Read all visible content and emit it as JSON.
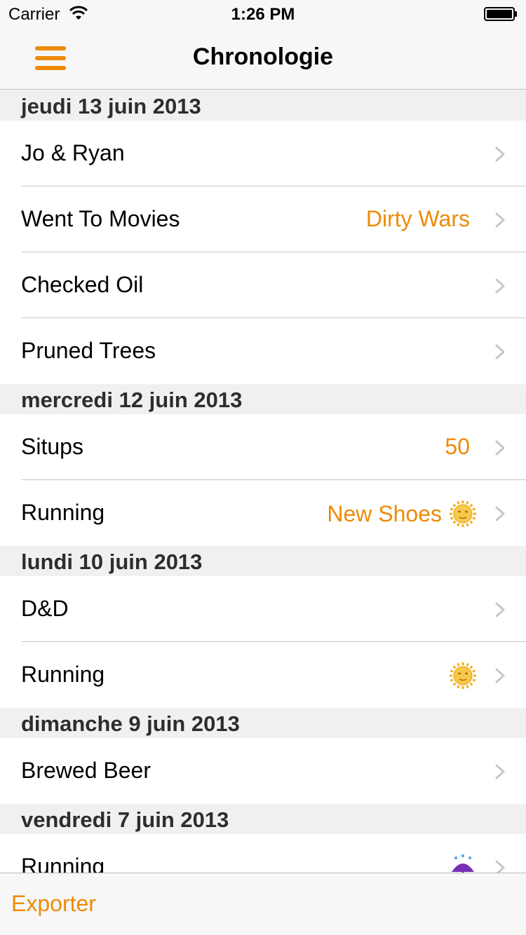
{
  "status_bar": {
    "carrier": "Carrier",
    "time": "1:26 PM"
  },
  "nav": {
    "title": "Chronologie",
    "menu_icon": "hamburger-menu-icon"
  },
  "accent_color": "#ee8a06",
  "sections": [
    {
      "date": "jeudi 13 juin 2013",
      "rows": [
        {
          "title": "Jo & Ryan",
          "detail": "",
          "icon": ""
        },
        {
          "title": "Went To Movies",
          "detail": "Dirty Wars",
          "icon": ""
        },
        {
          "title": "Checked Oil",
          "detail": "",
          "icon": ""
        },
        {
          "title": "Pruned Trees",
          "detail": "",
          "icon": ""
        }
      ]
    },
    {
      "date": "mercredi 12 juin 2013",
      "rows": [
        {
          "title": "Situps",
          "detail": "50",
          "icon": ""
        },
        {
          "title": "Running",
          "detail": "New Shoes",
          "icon": "sun-with-face-icon"
        }
      ]
    },
    {
      "date": "lundi 10 juin 2013",
      "rows": [
        {
          "title": "D&D",
          "detail": "",
          "icon": ""
        },
        {
          "title": "Running",
          "detail": "",
          "icon": "sun-with-face-icon"
        }
      ]
    },
    {
      "date": "dimanche 9 juin 2013",
      "rows": [
        {
          "title": "Brewed Beer",
          "detail": "",
          "icon": ""
        }
      ]
    },
    {
      "date": "vendredi 7 juin 2013",
      "rows": [
        {
          "title": "Running",
          "detail": "",
          "icon": "umbrella-with-rain-icon"
        }
      ]
    }
  ],
  "toolbar": {
    "export_label": "Exporter"
  }
}
